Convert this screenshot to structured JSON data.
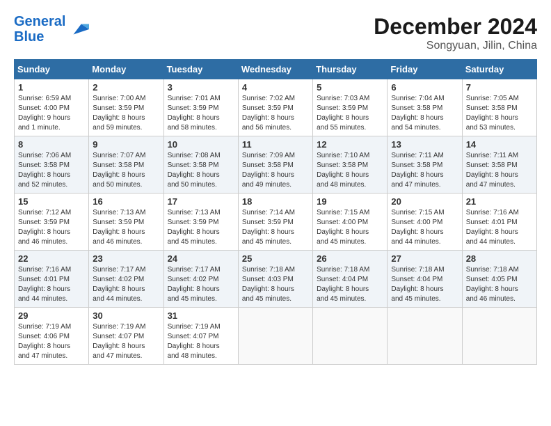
{
  "header": {
    "logo_line1": "General",
    "logo_line2": "Blue",
    "month": "December 2024",
    "location": "Songyuan, Jilin, China"
  },
  "weekdays": [
    "Sunday",
    "Monday",
    "Tuesday",
    "Wednesday",
    "Thursday",
    "Friday",
    "Saturday"
  ],
  "weeks": [
    [
      {
        "day": "1",
        "info": "Sunrise: 6:59 AM\nSunset: 4:00 PM\nDaylight: 9 hours\nand 1 minute."
      },
      {
        "day": "2",
        "info": "Sunrise: 7:00 AM\nSunset: 3:59 PM\nDaylight: 8 hours\nand 59 minutes."
      },
      {
        "day": "3",
        "info": "Sunrise: 7:01 AM\nSunset: 3:59 PM\nDaylight: 8 hours\nand 58 minutes."
      },
      {
        "day": "4",
        "info": "Sunrise: 7:02 AM\nSunset: 3:59 PM\nDaylight: 8 hours\nand 56 minutes."
      },
      {
        "day": "5",
        "info": "Sunrise: 7:03 AM\nSunset: 3:59 PM\nDaylight: 8 hours\nand 55 minutes."
      },
      {
        "day": "6",
        "info": "Sunrise: 7:04 AM\nSunset: 3:58 PM\nDaylight: 8 hours\nand 54 minutes."
      },
      {
        "day": "7",
        "info": "Sunrise: 7:05 AM\nSunset: 3:58 PM\nDaylight: 8 hours\nand 53 minutes."
      }
    ],
    [
      {
        "day": "8",
        "info": "Sunrise: 7:06 AM\nSunset: 3:58 PM\nDaylight: 8 hours\nand 52 minutes."
      },
      {
        "day": "9",
        "info": "Sunrise: 7:07 AM\nSunset: 3:58 PM\nDaylight: 8 hours\nand 50 minutes."
      },
      {
        "day": "10",
        "info": "Sunrise: 7:08 AM\nSunset: 3:58 PM\nDaylight: 8 hours\nand 50 minutes."
      },
      {
        "day": "11",
        "info": "Sunrise: 7:09 AM\nSunset: 3:58 PM\nDaylight: 8 hours\nand 49 minutes."
      },
      {
        "day": "12",
        "info": "Sunrise: 7:10 AM\nSunset: 3:58 PM\nDaylight: 8 hours\nand 48 minutes."
      },
      {
        "day": "13",
        "info": "Sunrise: 7:11 AM\nSunset: 3:58 PM\nDaylight: 8 hours\nand 47 minutes."
      },
      {
        "day": "14",
        "info": "Sunrise: 7:11 AM\nSunset: 3:58 PM\nDaylight: 8 hours\nand 47 minutes."
      }
    ],
    [
      {
        "day": "15",
        "info": "Sunrise: 7:12 AM\nSunset: 3:59 PM\nDaylight: 8 hours\nand 46 minutes."
      },
      {
        "day": "16",
        "info": "Sunrise: 7:13 AM\nSunset: 3:59 PM\nDaylight: 8 hours\nand 46 minutes."
      },
      {
        "day": "17",
        "info": "Sunrise: 7:13 AM\nSunset: 3:59 PM\nDaylight: 8 hours\nand 45 minutes."
      },
      {
        "day": "18",
        "info": "Sunrise: 7:14 AM\nSunset: 3:59 PM\nDaylight: 8 hours\nand 45 minutes."
      },
      {
        "day": "19",
        "info": "Sunrise: 7:15 AM\nSunset: 4:00 PM\nDaylight: 8 hours\nand 45 minutes."
      },
      {
        "day": "20",
        "info": "Sunrise: 7:15 AM\nSunset: 4:00 PM\nDaylight: 8 hours\nand 44 minutes."
      },
      {
        "day": "21",
        "info": "Sunrise: 7:16 AM\nSunset: 4:01 PM\nDaylight: 8 hours\nand 44 minutes."
      }
    ],
    [
      {
        "day": "22",
        "info": "Sunrise: 7:16 AM\nSunset: 4:01 PM\nDaylight: 8 hours\nand 44 minutes."
      },
      {
        "day": "23",
        "info": "Sunrise: 7:17 AM\nSunset: 4:02 PM\nDaylight: 8 hours\nand 44 minutes."
      },
      {
        "day": "24",
        "info": "Sunrise: 7:17 AM\nSunset: 4:02 PM\nDaylight: 8 hours\nand 45 minutes."
      },
      {
        "day": "25",
        "info": "Sunrise: 7:18 AM\nSunset: 4:03 PM\nDaylight: 8 hours\nand 45 minutes."
      },
      {
        "day": "26",
        "info": "Sunrise: 7:18 AM\nSunset: 4:04 PM\nDaylight: 8 hours\nand 45 minutes."
      },
      {
        "day": "27",
        "info": "Sunrise: 7:18 AM\nSunset: 4:04 PM\nDaylight: 8 hours\nand 45 minutes."
      },
      {
        "day": "28",
        "info": "Sunrise: 7:18 AM\nSunset: 4:05 PM\nDaylight: 8 hours\nand 46 minutes."
      }
    ],
    [
      {
        "day": "29",
        "info": "Sunrise: 7:19 AM\nSunset: 4:06 PM\nDaylight: 8 hours\nand 47 minutes."
      },
      {
        "day": "30",
        "info": "Sunrise: 7:19 AM\nSunset: 4:07 PM\nDaylight: 8 hours\nand 47 minutes."
      },
      {
        "day": "31",
        "info": "Sunrise: 7:19 AM\nSunset: 4:07 PM\nDaylight: 8 hours\nand 48 minutes."
      },
      {
        "day": "",
        "info": ""
      },
      {
        "day": "",
        "info": ""
      },
      {
        "day": "",
        "info": ""
      },
      {
        "day": "",
        "info": ""
      }
    ]
  ]
}
